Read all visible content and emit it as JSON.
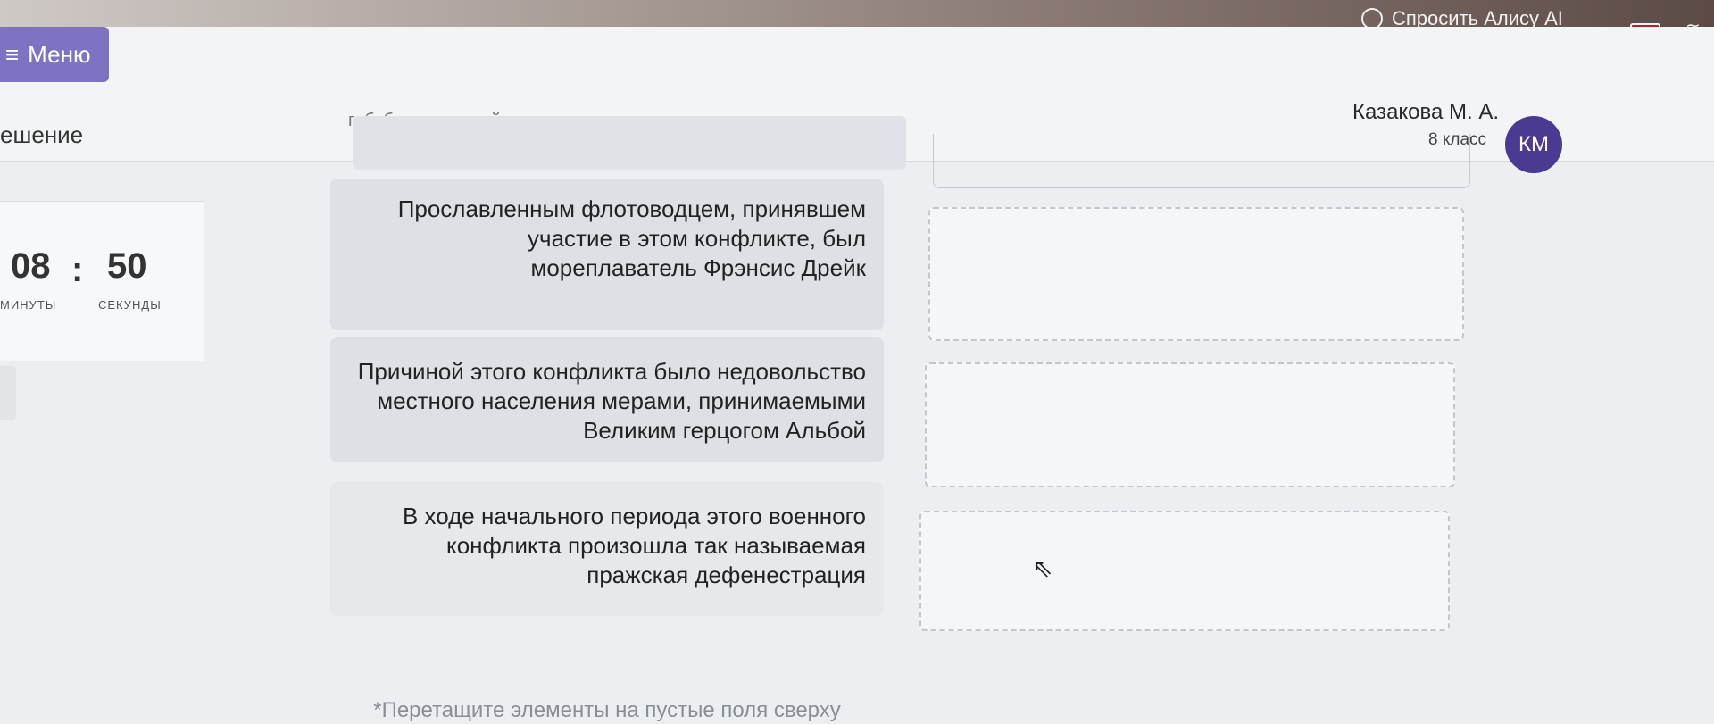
{
  "system_bar": {
    "assistant_label": "Спросить Алису AI"
  },
  "header": {
    "menu_label": "Меню",
    "subject": "ешение",
    "breadcrumb_fragment": "габсбургскими войсками",
    "user": {
      "name": "Казакова М. А.",
      "class": "8 класс",
      "initials": "КМ"
    }
  },
  "timer": {
    "minutes": "08",
    "separator": ":",
    "seconds": "50",
    "minutes_label": "МИНУТЫ",
    "seconds_label": "СЕКУНДЫ"
  },
  "statements": [
    {
      "text": "Прославленным флотоводцем, принявшем участие в этом конфликте, был мореплаватель Фрэнсис Дрейк"
    },
    {
      "text": "Причиной этого конфликта было недовольство местного населения мерами, принимаемыми Великим герцогом Альбой"
    },
    {
      "text": "В ходе начального периода этого военного конфликта произошла так называемая пражская дефенестрация"
    }
  ],
  "hint": "*Перетащите элементы на пустые поля сверху"
}
